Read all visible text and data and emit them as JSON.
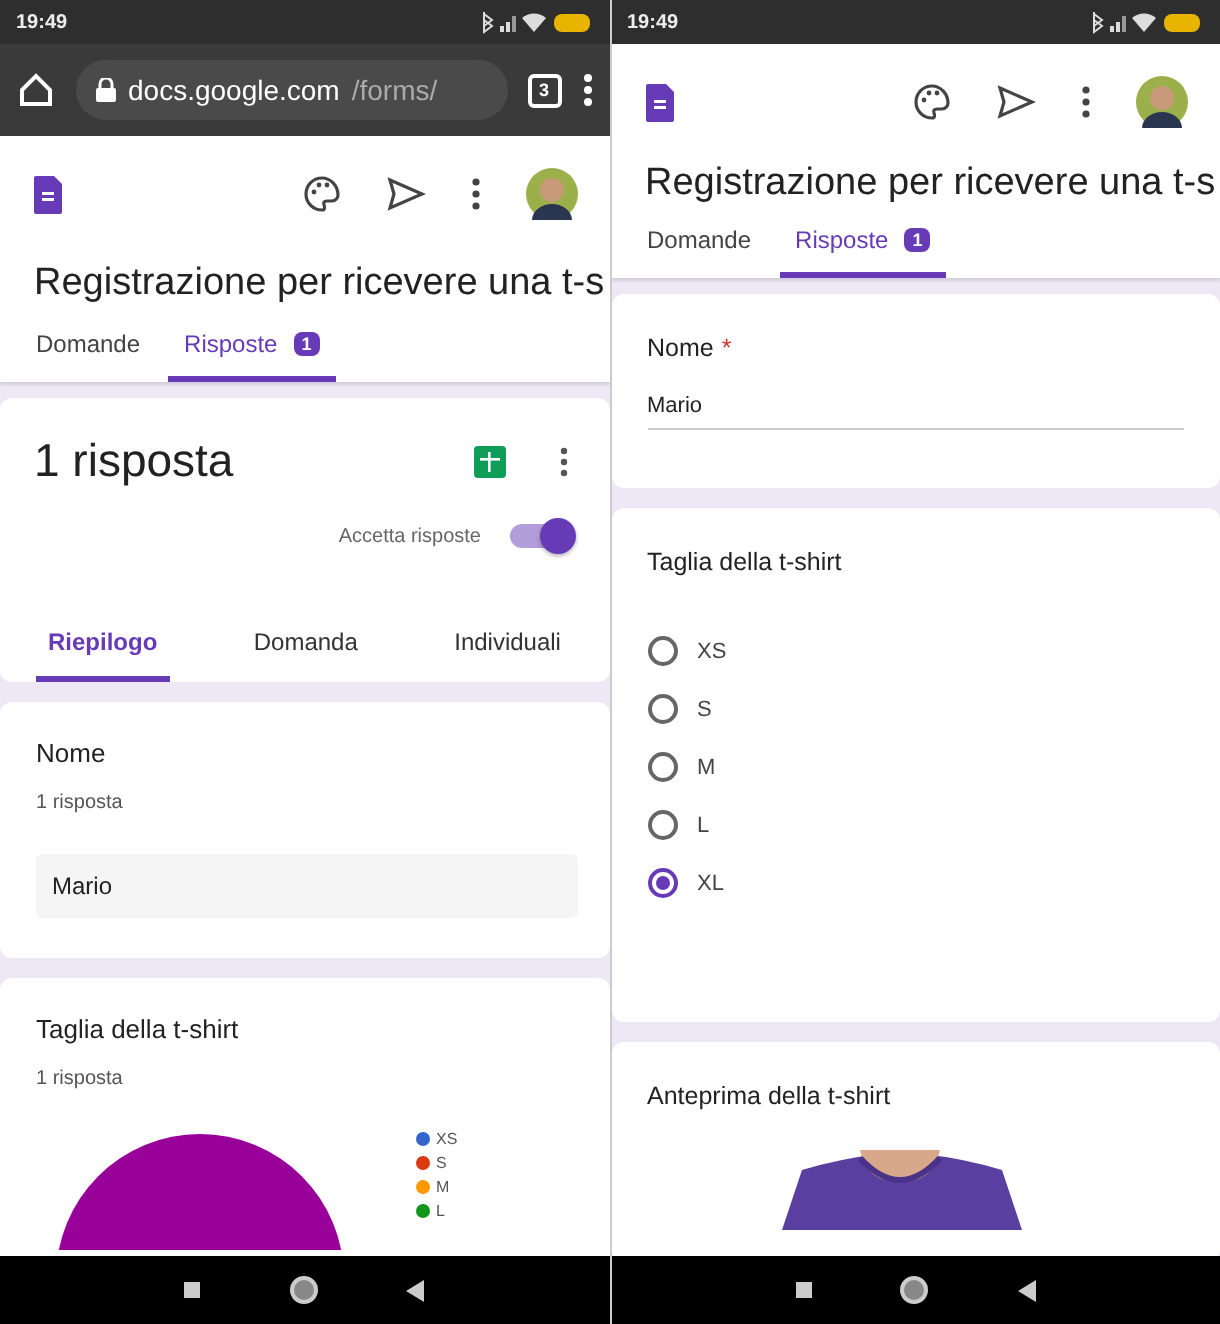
{
  "left_phone": {
    "status_bar": {
      "time": "19:49"
    },
    "browser": {
      "url_host": "docs.google.com",
      "url_path": "/forms/",
      "tab_count": "3"
    },
    "form_title": "Registrazione per ricevere una t-s",
    "tabs": [
      {
        "label": "Domande",
        "selected": false
      },
      {
        "label": "Risposte",
        "selected": true,
        "badge": "1"
      }
    ],
    "summary": {
      "title": "1 risposta",
      "accept_label": "Accetta risposte",
      "accepting": true,
      "subtabs": [
        {
          "label": "Riepilogo",
          "selected": true
        },
        {
          "label": "Domanda",
          "selected": false
        },
        {
          "label": "Individuali",
          "selected": false
        }
      ]
    },
    "questions": [
      {
        "kind": "text",
        "title": "Nome",
        "count": "1 risposta",
        "answers": [
          "Mario"
        ]
      },
      {
        "kind": "pie",
        "title": "Taglia della t-shirt",
        "count": "1 risposta",
        "legend": [
          {
            "label": "XS",
            "color": "#3366cc"
          },
          {
            "label": "S",
            "color": "#dc3912"
          },
          {
            "label": "M",
            "color": "#ff9900"
          },
          {
            "label": "L",
            "color": "#109618"
          }
        ]
      }
    ]
  },
  "right_phone": {
    "status_bar": {
      "time": "19:49"
    },
    "form_title": "Registrazione per ricevere una t-s",
    "tabs": [
      {
        "label": "Domande",
        "selected": false
      },
      {
        "label": "Risposte",
        "selected": true,
        "badge": "1"
      }
    ],
    "questions": [
      {
        "kind": "text",
        "title": "Nome",
        "required_mark": "*",
        "value": "Mario"
      },
      {
        "kind": "radio",
        "title": "Taglia della t-shirt",
        "options": [
          {
            "label": "XS",
            "selected": false
          },
          {
            "label": "S",
            "selected": false
          },
          {
            "label": "M",
            "selected": false
          },
          {
            "label": "L",
            "selected": false
          },
          {
            "label": "XL",
            "selected": true
          }
        ]
      },
      {
        "title": "Anteprima della t-shirt"
      }
    ]
  }
}
